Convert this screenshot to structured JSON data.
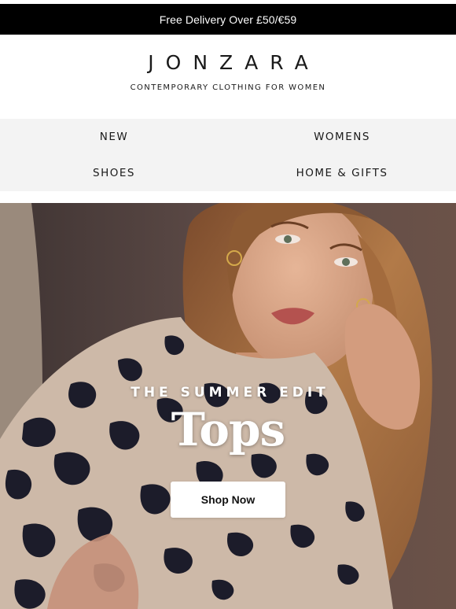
{
  "topbar": {
    "text": "Free Delivery Over £50/€59"
  },
  "brand": {
    "logo": "JONZARA",
    "tagline": "CONTEMPORARY CLOTHING FOR WOMEN"
  },
  "nav": {
    "items": [
      {
        "label": "NEW"
      },
      {
        "label": "WOMENS"
      },
      {
        "label": "SHOES"
      },
      {
        "label": "HOME & GIFTS"
      }
    ]
  },
  "hero": {
    "eyebrow": "THE SUMMER EDIT",
    "headline": "Tops",
    "cta_label": "Shop Now",
    "image": "woman-leopard-print-top-photo",
    "colors": {
      "hair": "#a06a3e",
      "skin": "#d9a486",
      "print_base": "#cbb7a7",
      "print_spots": "#1c1c2a",
      "backdrop": "#5b4a45"
    }
  }
}
